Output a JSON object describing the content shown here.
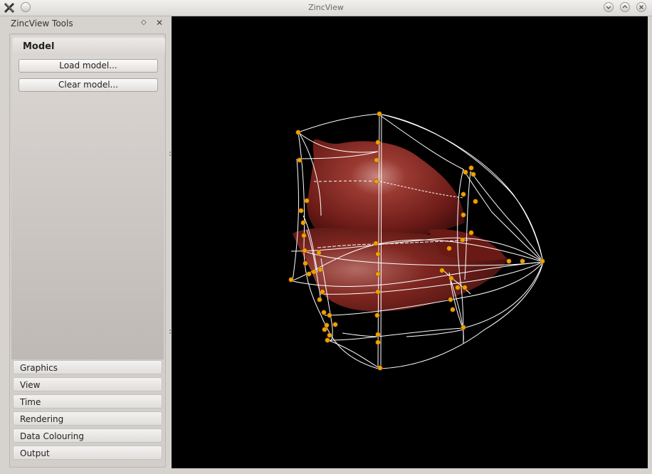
{
  "window": {
    "title": "ZincView"
  },
  "dock": {
    "title": "ZincView Tools",
    "float_icon": "◇",
    "close_icon": "✕"
  },
  "toolbox": {
    "active_page": "Model",
    "model_buttons": [
      "Load model...",
      "Clear model..."
    ],
    "pages": [
      "Graphics",
      "View",
      "Time",
      "Rendering",
      "Data Colouring",
      "Output"
    ]
  },
  "colors": {
    "mesh_line": "#ffffff",
    "node": "#f0a000",
    "surface": "#8b2a24",
    "background": "#000000"
  }
}
